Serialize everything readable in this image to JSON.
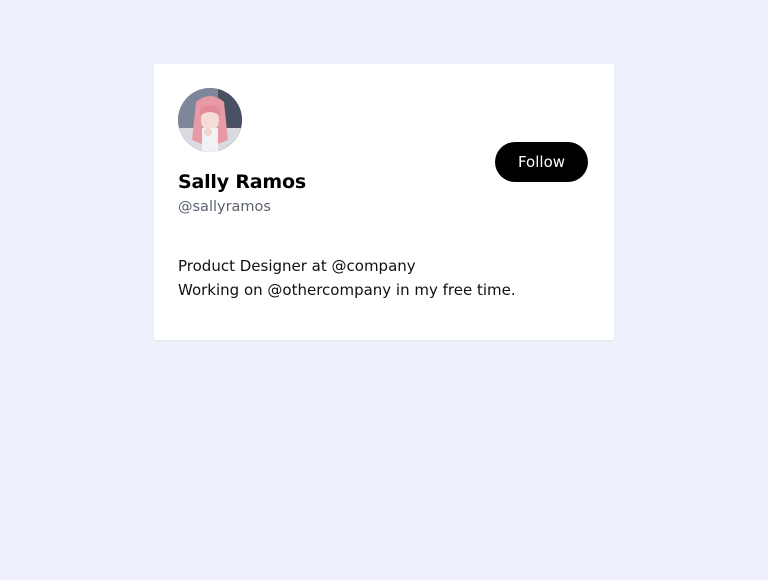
{
  "profile": {
    "name": "Sally Ramos",
    "handle": "@sallyramos",
    "bio_line_1": "Product Designer at @company",
    "bio_line_2": "Working on @othercompany in my free time.",
    "follow_label": "Follow"
  },
  "colors": {
    "page_background": "#eef1fd",
    "card_background": "#ffffff",
    "button_background": "#000000",
    "button_text": "#ffffff",
    "handle_text": "#5b6370"
  }
}
